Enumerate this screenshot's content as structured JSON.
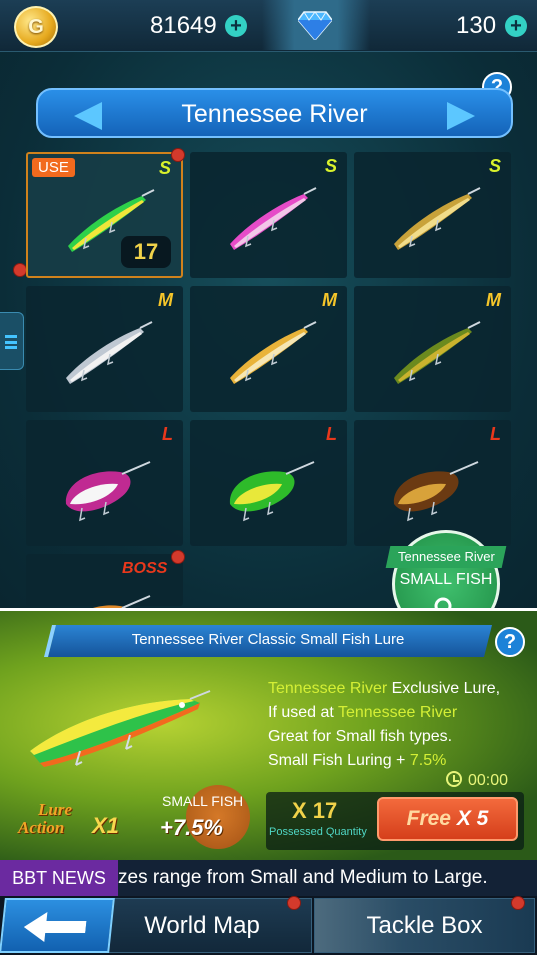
{
  "topbar": {
    "coin_icon_letter": "G",
    "coins": "81649",
    "gems": "130",
    "coin_plus": "+",
    "gem_plus": "+"
  },
  "region": {
    "name": "Tennessee River",
    "help": "?"
  },
  "lures": [
    {
      "size": "S",
      "badge": "USE",
      "quantity": "17",
      "selected": true,
      "colors": [
        "#2ed14a",
        "#f0e63a"
      ]
    },
    {
      "size": "S",
      "colors": [
        "#e64cc8",
        "#f2c6e8"
      ]
    },
    {
      "size": "S",
      "colors": [
        "#c8a23a",
        "#f1dc8a"
      ]
    },
    {
      "size": "M",
      "colors": [
        "#bfc8d2",
        "#f2f2f2"
      ]
    },
    {
      "size": "M",
      "colors": [
        "#e9b33a",
        "#f6e6b4"
      ]
    },
    {
      "size": "M",
      "colors": [
        "#6b8a1e",
        "#c9b22e"
      ]
    },
    {
      "size": "L",
      "colors": [
        "#c02a92",
        "#f6f6f6"
      ]
    },
    {
      "size": "L",
      "colors": [
        "#2ebb2a",
        "#e8e83a"
      ]
    },
    {
      "size": "L",
      "colors": [
        "#6b3a12",
        "#d8a23a"
      ]
    },
    {
      "size": "BOSS",
      "colors": [
        "#e08a2a",
        "#f6d88a"
      ]
    }
  ],
  "filter": {
    "region": "Tennessee River",
    "label": "SMALL FISH"
  },
  "detail": {
    "title": "Tennessee River Classic Small Fish Lure",
    "help": "?",
    "line1_highlight": "Tennessee River",
    "line1_rest": " Exclusive Lure,",
    "line2_prefix": "If used at ",
    "line2_highlight": "Tennessee River",
    "line3": "Great for Small fish types.",
    "line4_prefix": "Small Fish Luring + ",
    "line4_highlight": "7.5%",
    "timer": "00:00",
    "lure_action_line1": "Lure",
    "lure_action_line2": "Action",
    "lure_action_mult": "X1",
    "bonus_label": "SMALL FISH",
    "bonus_value": "+7.5%",
    "possessed": "X 17",
    "possessed_label": "Possessed Quantity",
    "free_label": "Free",
    "free_mult": "X 5"
  },
  "news": {
    "label": "BBT NEWS",
    "text": "zes range from Small and Medium to Large."
  },
  "nav": {
    "world_map": "World Map",
    "tackle_box": "Tackle Box"
  }
}
